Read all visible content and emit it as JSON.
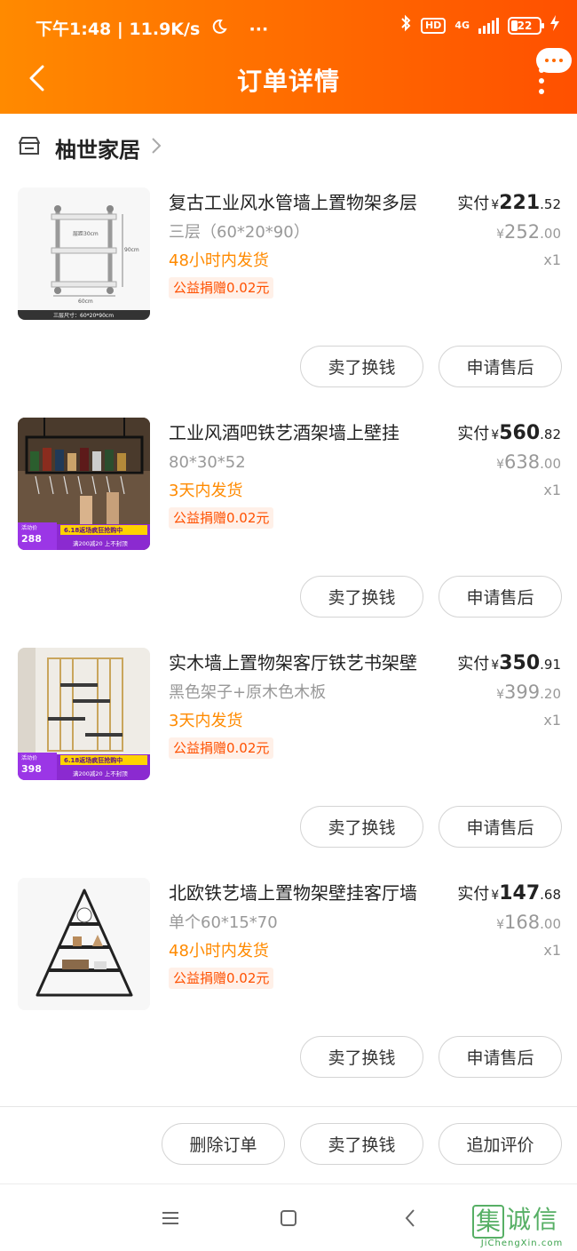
{
  "status_bar": {
    "time_speed": "下午1:48 | 11.9K/s",
    "hd": "HD",
    "network": "4G",
    "battery": "22",
    "more": "···"
  },
  "header": {
    "title": "订单详情"
  },
  "shop": {
    "name": "柚世家居"
  },
  "items": [
    {
      "title": "复古工业风水管墙上置物架多层",
      "sku": "三层（60*20*90）",
      "shipping": "48小时内发货",
      "donation": "公益捐赠0.02元",
      "paid_label": "实付",
      "currency": "¥",
      "paid_int": "221",
      "paid_dec": ".52",
      "orig_int": "252",
      "orig_dec": ".00",
      "qty": "x1",
      "sell_btn": "卖了换钱",
      "after_btn": "申请售后",
      "thumb_labels": {
        "h": "层距30cm",
        "v": "90cm",
        "w": "60cm",
        "caption": "三层尺寸：60*20*90cm"
      }
    },
    {
      "title": "工业风酒吧铁艺酒架墙上壁挂",
      "sku": "80*30*52",
      "shipping": "3天内发货",
      "donation": "公益捐赠0.02元",
      "paid_label": "实付",
      "currency": "¥",
      "paid_int": "560",
      "paid_dec": ".82",
      "orig_int": "638",
      "orig_dec": ".00",
      "qty": "x1",
      "sell_btn": "卖了换钱",
      "after_btn": "申请售后",
      "promo": {
        "tag": "活动价",
        "price": "288",
        "banner": "6.18返场疯狂抢购中",
        "sub": "满200减20 上不封顶"
      }
    },
    {
      "title": "实木墙上置物架客厅铁艺书架壁",
      "sku": "黑色架子+原木色木板",
      "shipping": "3天内发货",
      "donation": "公益捐赠0.02元",
      "paid_label": "实付",
      "currency": "¥",
      "paid_int": "350",
      "paid_dec": ".91",
      "orig_int": "399",
      "orig_dec": ".20",
      "qty": "x1",
      "sell_btn": "卖了换钱",
      "after_btn": "申请售后",
      "promo": {
        "tag": "活动价",
        "price": "398",
        "banner": "6.18返场疯狂抢购中",
        "sub": "满200减20 上不封顶"
      }
    },
    {
      "title": "北欧铁艺墙上置物架壁挂客厅墙",
      "sku": "单个60*15*70",
      "shipping": "48小时内发货",
      "donation": "公益捐赠0.02元",
      "paid_label": "实付",
      "currency": "¥",
      "paid_int": "147",
      "paid_dec": ".68",
      "orig_int": "168",
      "orig_dec": ".00",
      "qty": "x1",
      "sell_btn": "卖了换钱",
      "after_btn": "申请售后"
    }
  ],
  "bottom_actions": {
    "delete": "删除订单",
    "sell": "卖了换钱",
    "review": "追加评价"
  },
  "watermark": {
    "chars": [
      "集",
      "诚",
      "信"
    ],
    "url": "JiChengXin.com"
  },
  "colors": {
    "header_start": "#ff8a00",
    "header_end": "#ff5000",
    "shipping": "#ff8a00",
    "donation": "#ff5000",
    "promo": "#b52ae0"
  }
}
